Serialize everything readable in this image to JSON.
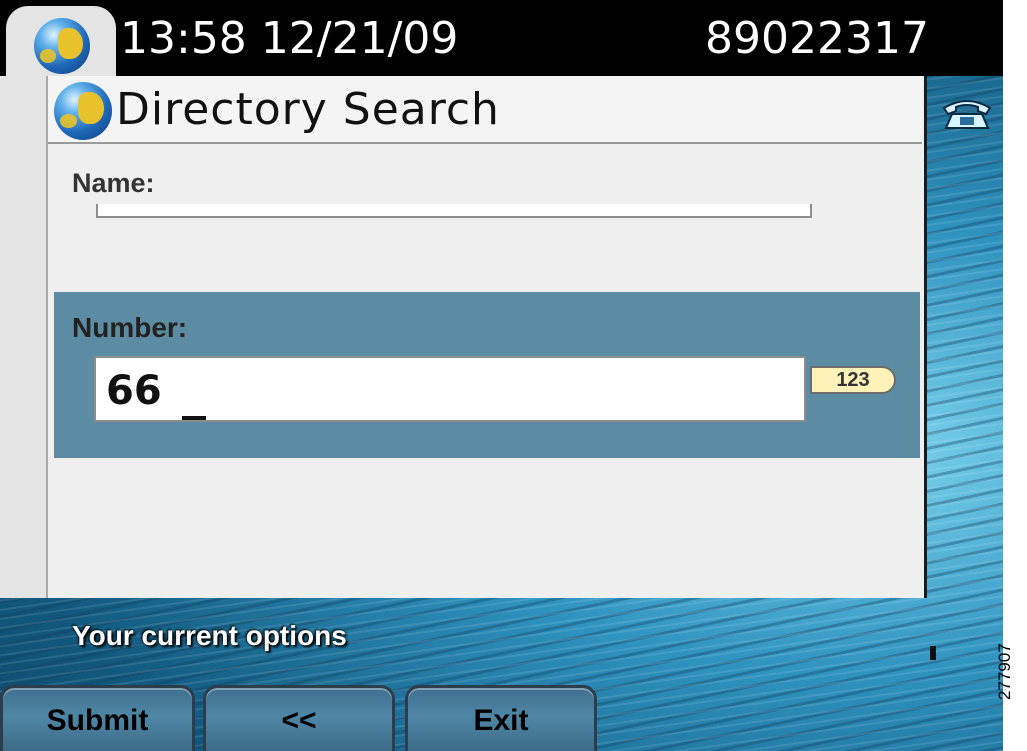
{
  "status_bar": {
    "clock": "13:58 12/21/09",
    "extension": "89022317",
    "app_icon": "globe-icon"
  },
  "window": {
    "title": "Directory Search",
    "title_icon": "globe-icon",
    "fields": {
      "name_label": "Name:",
      "name_value": "",
      "number_label": "Number:",
      "number_value": "66",
      "input_mode": "123"
    },
    "colors": {
      "selected_row": "#5c8ca3",
      "badge": "#fff2b8"
    }
  },
  "line_icon": "phone-icon",
  "softkeys": {
    "heading": "Your current options",
    "submit": "Submit",
    "back": "<<",
    "exit": "Exit"
  },
  "figure_id": "277907"
}
